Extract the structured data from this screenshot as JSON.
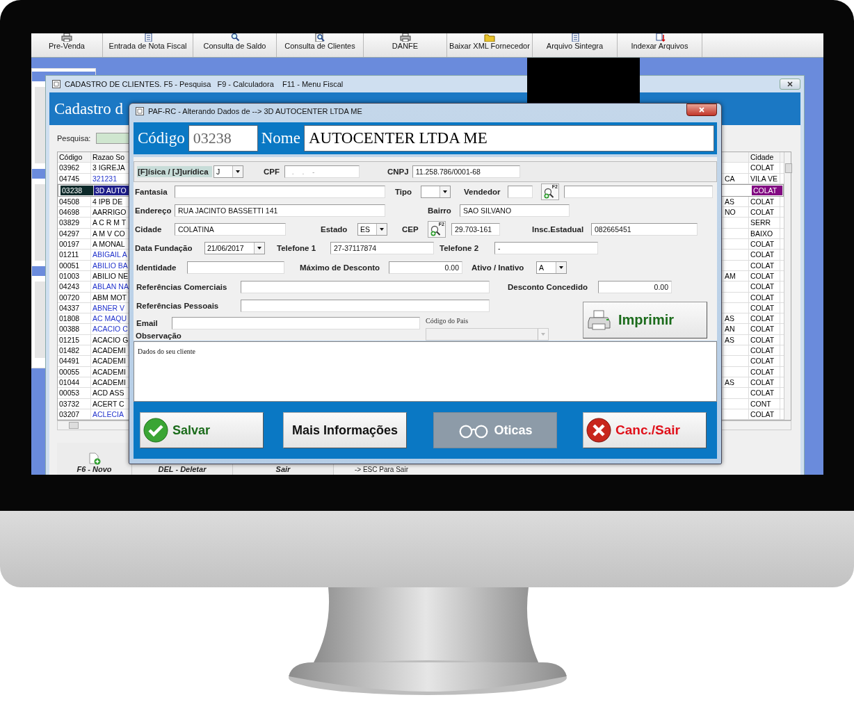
{
  "toolbar": [
    {
      "label": "Pre-Venda"
    },
    {
      "label": "Entrada de Nota Fiscal"
    },
    {
      "label": "Consulta de Saldo"
    },
    {
      "label": "Consulta de Clientes"
    },
    {
      "label": "DANFE"
    },
    {
      "label": "Baixar XML Fornecedor"
    },
    {
      "label": "Arquivo Sintegra"
    },
    {
      "label": "Indexar Arquivos"
    }
  ],
  "main_window": {
    "title": "CADASTRO DE CLIENTES. F5 - Pesquisa   F9 - Calculadora    F11 - Menu Fiscal",
    "heading": "Cadastro d",
    "search": {
      "label": "Pesquisa:"
    },
    "table": {
      "columns": [
        "Código",
        "Razao So",
        "Cidade"
      ],
      "rows": [
        {
          "codigo": "03962",
          "razao": "3 IGREJA",
          "cidade": "COLAT",
          "color": "#000000",
          "selected": false
        },
        {
          "codigo": "04745",
          "razao": "321231",
          "column_3": "CA",
          "cidade": "VILA VE",
          "color": "#2233cc",
          "selected": false
        },
        {
          "codigo": "03238",
          "razao": "3D AUTO",
          "cidade": "COLAT",
          "selected": true
        },
        {
          "codigo": "04508",
          "razao": "4 IPB DE",
          "column_3": "AS",
          "cidade": "COLAT",
          "color": "#000000",
          "selected": false
        },
        {
          "codigo": "04698",
          "razao": "AARRIGO",
          "column_3": "NO",
          "cidade": "COLAT",
          "color": "#000000",
          "selected": false
        },
        {
          "codigo": "03829",
          "razao": "A C R M T",
          "cidade": "SERR",
          "color": "#000000",
          "selected": false
        },
        {
          "codigo": "04297",
          "razao": "A M V CO",
          "cidade": "BAIXO",
          "color": "#000000",
          "selected": false
        },
        {
          "codigo": "00197",
          "razao": "A MONAL",
          "cidade": "COLAT",
          "color": "#000000",
          "selected": false
        },
        {
          "codigo": "01211",
          "razao": "ABIGAIL A",
          "cidade": "COLAT",
          "color": "#2233cc",
          "selected": false
        },
        {
          "codigo": "00051",
          "razao": "ABILIO BA",
          "cidade": "COLAT",
          "color": "#2233cc",
          "selected": false
        },
        {
          "codigo": "01003",
          "razao": "ABILIO NE",
          "column_3": "AM",
          "cidade": "COLAT",
          "color": "#000000",
          "selected": false
        },
        {
          "codigo": "04243",
          "razao": "ABLAN NA",
          "cidade": "COLAT",
          "color": "#2233cc",
          "selected": false
        },
        {
          "codigo": "00720",
          "razao": "ABM MOT",
          "cidade": "COLAT",
          "color": "#000000",
          "selected": false
        },
        {
          "codigo": "04337",
          "razao": "ABNER V",
          "cidade": "COLAT",
          "color": "#2233cc",
          "selected": false
        },
        {
          "codigo": "01808",
          "razao": "AC MAQU",
          "column_3": "AS",
          "cidade": "COLAT",
          "color": "#2233cc",
          "selected": false
        },
        {
          "codigo": "00388",
          "razao": "ACACIO C",
          "column_3": "AN",
          "cidade": "COLAT",
          "color": "#2233cc",
          "selected": false
        },
        {
          "codigo": "01215",
          "razao": "ACACIO G",
          "column_3": "AS",
          "cidade": "COLAT",
          "color": "#000000",
          "selected": false
        },
        {
          "codigo": "01482",
          "razao": "ACADEMI",
          "cidade": "COLAT",
          "color": "#000000",
          "selected": false
        },
        {
          "codigo": "04491",
          "razao": "ACADEMI",
          "cidade": "COLAT",
          "color": "#000000",
          "selected": false
        },
        {
          "codigo": "00055",
          "razao": "ACADEMI",
          "cidade": "COLAT",
          "color": "#000000",
          "selected": false
        },
        {
          "codigo": "01044",
          "razao": "ACADEMI",
          "column_3": "AS",
          "cidade": "COLAT",
          "color": "#000000",
          "selected": false
        },
        {
          "codigo": "00053",
          "razao": "ACD ASS",
          "cidade": "COLAT",
          "color": "#000000",
          "selected": false
        },
        {
          "codigo": "03732",
          "razao": "ACERT C",
          "cidade": "CONT",
          "color": "#000000",
          "selected": false
        },
        {
          "codigo": "03207",
          "razao": "ACLECIA",
          "cidade": "COLAT",
          "color": "#2233cc",
          "selected": false
        }
      ]
    },
    "bottom_buttons": [
      {
        "label": "F6 - Novo"
      },
      {
        "label": "DEL - Deletar"
      },
      {
        "label": "Sair"
      }
    ],
    "hint": "-> ESC Para Sair"
  },
  "dialog": {
    "title": "PAF-RC - Alterando Dados de --> 3D AUTOCENTER LTDA ME",
    "codigo": {
      "label": "Código",
      "value": "03238"
    },
    "nome": {
      "label": "Nome",
      "value": "AUTOCENTER LTDA ME"
    },
    "form": {
      "tipo_pessoa": {
        "label": "[F]ísica / [J]urídica",
        "value": "J",
        "focused": true
      },
      "cpf": {
        "label": "CPF",
        "placeholder": "  .    .    -"
      },
      "cnpj": {
        "label": "CNPJ",
        "value": "11.258.786/0001-68"
      },
      "fantasia": {
        "label": "Fantasia"
      },
      "tipo": {
        "label": "Tipo"
      },
      "vendedor": {
        "label": "Vendedor",
        "lookup_key": "F2"
      },
      "endereco": {
        "label": "Endereço",
        "value": "RUA JACINTO BASSETTI 141"
      },
      "bairro": {
        "label": "Bairro",
        "value": "SAO SILVANO"
      },
      "cidade": {
        "label": "Cidade",
        "value": "COLATINA"
      },
      "estado": {
        "label": "Estado",
        "value": "ES"
      },
      "cep": {
        "label": "CEP",
        "lookup_key": "F2",
        "value": "29.703-161"
      },
      "insc_estadual": {
        "label": "Insc.Estadual",
        "value": "082665451"
      },
      "data_fundacao": {
        "label": "Data Fundação",
        "value": "21/06/2017"
      },
      "telefone_1": {
        "label": "Telefone 1",
        "value": "27-37117874"
      },
      "telefone_2": {
        "label": "Telefone 2",
        "value": "-"
      },
      "identidade": {
        "label": "Identidade"
      },
      "maximo_desconto": {
        "label": "Máximo de Desconto",
        "value": "0.00"
      },
      "ativo_inativo": {
        "label": "Ativo / Inativo",
        "value": "A"
      },
      "referencias_comerciais": {
        "label": "Referências Comerciais"
      },
      "desconto_concedido": {
        "label": "Desconto Concedido",
        "value": "0.00"
      },
      "referencias_pessoais": {
        "label": "Referências Pessoais"
      },
      "email": {
        "label": "Email"
      },
      "codigo_pais": {
        "label": "Código do Pais",
        "disabled": true
      },
      "observacao": {
        "label": "Observação",
        "value": "Dados do seu cliente"
      }
    },
    "print_button": {
      "label": "Imprimir"
    },
    "buttons": [
      {
        "label": "Salvar",
        "kind": "save",
        "disabled": false
      },
      {
        "label": "Mais Informações",
        "kind": "info",
        "disabled": false
      },
      {
        "label": "Oticas",
        "kind": "optics",
        "disabled": true
      },
      {
        "label": "Canc./Sair",
        "kind": "cancel",
        "disabled": false
      }
    ]
  }
}
